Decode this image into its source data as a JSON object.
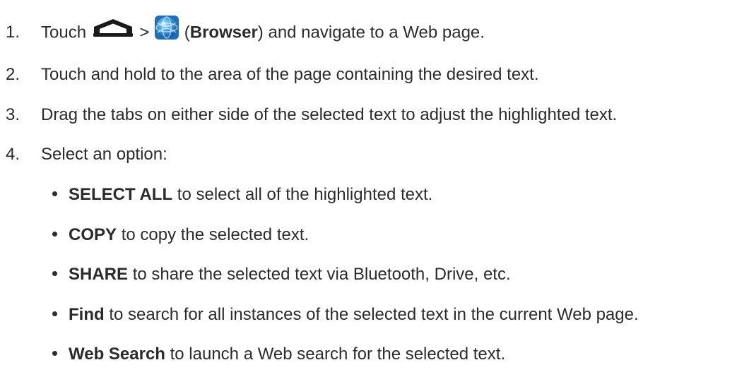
{
  "steps": [
    {
      "num": "1.",
      "before": "Touch",
      "sep": ">",
      "paren_open": "(",
      "bold": "Browser",
      "paren_close": ")",
      "after": "and navigate to a Web page.",
      "icons": [
        "home-icon",
        "browser-globe-icon"
      ]
    },
    {
      "num": "2.",
      "text": "Touch and hold to the area of the page containing the desired text."
    },
    {
      "num": "3.",
      "text": "Drag the tabs on either side of the selected text to adjust the highlighted text."
    },
    {
      "num": "4.",
      "text": "Select an option:"
    }
  ],
  "options": [
    {
      "bold": "SELECT ALL",
      "text": "to select all of the highlighted text."
    },
    {
      "bold": "COPY",
      "text": "to copy the selected text."
    },
    {
      "bold": "SHARE",
      "text": "to share the selected text via Bluetooth, Drive, etc."
    },
    {
      "bold": "Find",
      "text": "to search for all instances of the selected text in the current Web page."
    },
    {
      "bold": "Web Search",
      "text": "to launch a Web search for the selected text."
    }
  ],
  "colors": {
    "text": "#2b2b2b",
    "globe": "#2f8fd6"
  }
}
